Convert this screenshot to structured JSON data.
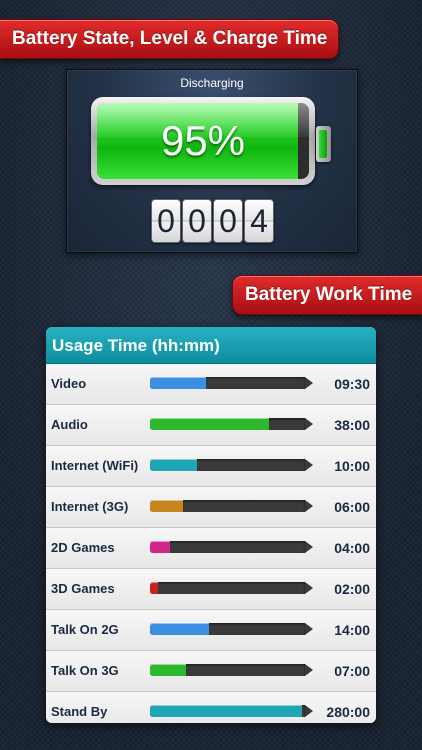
{
  "header_banner": {
    "title": "Battery State, Level & Charge Time"
  },
  "battery": {
    "state": "Discharging",
    "level_text": "95%",
    "level_fraction": 0.95,
    "charge_time_digits": [
      "0",
      "0",
      "0",
      "4"
    ]
  },
  "work_banner": {
    "title": "Battery Work Time"
  },
  "usage": {
    "title": "Usage Time (hh:mm)",
    "rows": [
      {
        "label": "Video",
        "time": "09:30",
        "fill": 0.36,
        "color": "#3b8ee0"
      },
      {
        "label": "Audio",
        "time": "38:00",
        "fill": 0.77,
        "color": "#2db82d"
      },
      {
        "label": "Internet (WiFi)",
        "time": "10:00",
        "fill": 0.3,
        "color": "#1fa6b5"
      },
      {
        "label": "Internet (3G)",
        "time": "06:00",
        "fill": 0.21,
        "color": "#c8851c"
      },
      {
        "label": "2D Games",
        "time": "04:00",
        "fill": 0.13,
        "color": "#d4258c"
      },
      {
        "label": "3D Games",
        "time": "02:00",
        "fill": 0.05,
        "color": "#c62222"
      },
      {
        "label": "Talk On 2G",
        "time": "14:00",
        "fill": 0.38,
        "color": "#3b8ee0"
      },
      {
        "label": "Talk On 3G",
        "time": "07:00",
        "fill": 0.23,
        "color": "#2db82d"
      },
      {
        "label": "Stand By",
        "time": "280:00",
        "fill": 0.98,
        "color": "#1fa6b5"
      }
    ]
  }
}
